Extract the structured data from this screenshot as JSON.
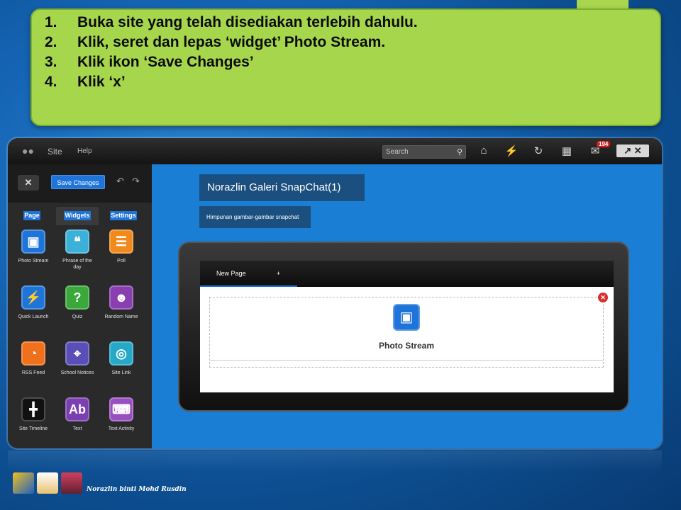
{
  "instructions": [
    {
      "num": "1.",
      "text": "Buka site yang telah disediakan terlebih dahulu."
    },
    {
      "num": "2.",
      "text": "Klik, seret dan lepas ‘widget’ Photo Stream."
    },
    {
      "num": "3.",
      "text": "Klik ikon ‘Save Changes’"
    },
    {
      "num": "4.",
      "text": "Klik ‘x’"
    }
  ],
  "topbar": {
    "site_label": "Site",
    "help_label": "Help",
    "search_placeholder": "Search",
    "notification_count": "194",
    "icons": [
      "home-icon",
      "quick-launch-icon",
      "refresh-icon",
      "sitemap-icon",
      "chat-icon"
    ]
  },
  "sidebar": {
    "save_label": "Save Changes",
    "tabs": [
      "Page",
      "Widgets",
      "Settings"
    ],
    "widgets": [
      {
        "label": "Photo Stream",
        "icon": "photo-stream-icon",
        "color": "#1e74d8"
      },
      {
        "label": "Phrase of the day",
        "icon": "phrase-icon",
        "color": "#3bb0d8"
      },
      {
        "label": "Poll",
        "icon": "poll-icon",
        "color": "#f08a1c"
      },
      {
        "label": "Quick Launch",
        "icon": "quick-launch-icon",
        "color": "#1e74d8"
      },
      {
        "label": "Quiz",
        "icon": "quiz-icon",
        "color": "#3aa83a"
      },
      {
        "label": "Random Name",
        "icon": "random-name-icon",
        "color": "#8a3fb0"
      },
      {
        "label": "RSS Feed",
        "icon": "rss-icon",
        "color": "#f0701c"
      },
      {
        "label": "School Notices",
        "icon": "pin-icon",
        "color": "#5a4fb8"
      },
      {
        "label": "Site Link",
        "icon": "globe-icon",
        "color": "#26a8c8"
      },
      {
        "label": "Site Timeline",
        "icon": "timeline-icon",
        "color": "#111111"
      },
      {
        "label": "Text",
        "icon": "text-icon",
        "color": "#7a3fb0"
      },
      {
        "label": "Text Activity",
        "icon": "keyboard-icon",
        "color": "#9a4fc0"
      }
    ]
  },
  "main": {
    "gallery_title": "Norazlin Galeri SnapChat(1)",
    "gallery_subtitle": "Himpunan gambar-gambar snapchat",
    "tab_new_page": "New Page",
    "tab_add": "+",
    "widget_label": "Photo Stream"
  },
  "footer": {
    "author": "Norazlin binti Mohd Rusdin"
  },
  "colors": {
    "instruction_bg": "#a6d64b",
    "accent_blue": "#1e74d8",
    "canvas_blue": "#1a7fd4"
  }
}
